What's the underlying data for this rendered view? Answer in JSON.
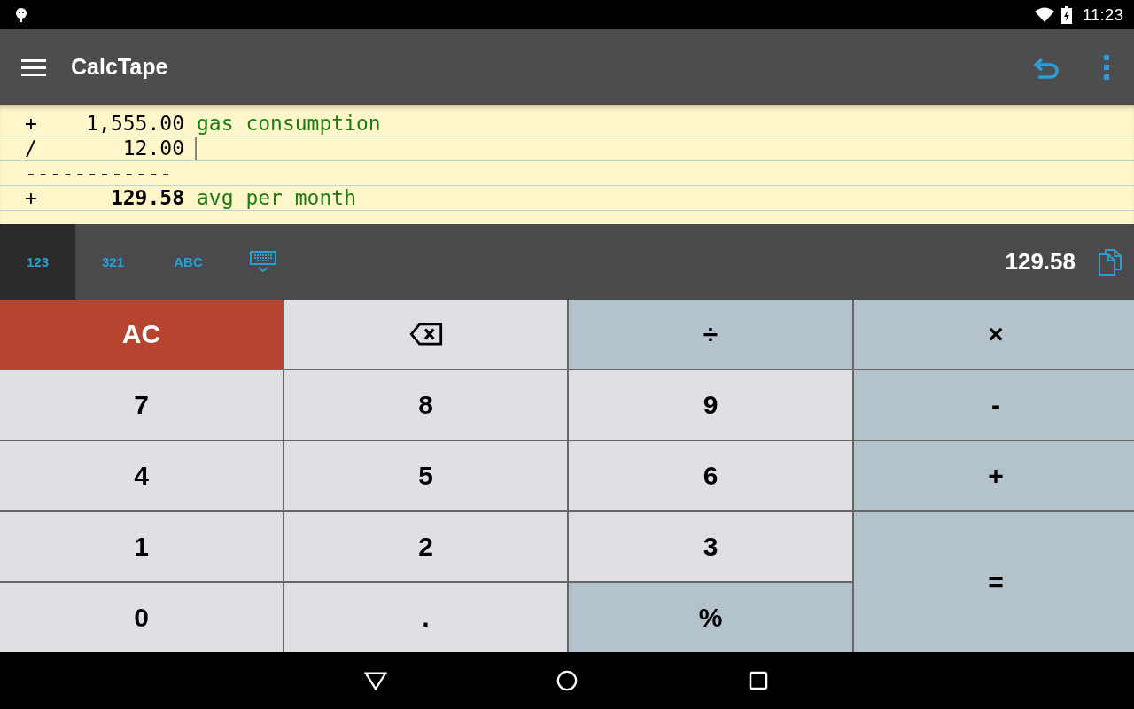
{
  "status_bar": {
    "time": "11:23"
  },
  "toolbar": {
    "title": "CalcTape"
  },
  "tape": [
    {
      "kind": "entry",
      "op": "+",
      "amount": "1,555.00",
      "comment": "gas consumption",
      "bold": false,
      "cursor": false
    },
    {
      "kind": "entry",
      "op": "/",
      "amount": "12.00",
      "bold": false,
      "cursor": true
    },
    {
      "kind": "separator",
      "text": "------------"
    },
    {
      "kind": "entry",
      "op": "+",
      "amount": "129.58",
      "comment": "avg per month",
      "bold": true,
      "cursor": false
    }
  ],
  "mode_tabs": [
    {
      "label": "123",
      "selected": true
    },
    {
      "label": "321",
      "selected": false
    },
    {
      "label": "ABC",
      "selected": false
    }
  ],
  "result": "129.58",
  "keys": [
    {
      "kind": "clear",
      "label": "AC"
    },
    {
      "kind": "backspace"
    },
    {
      "kind": "op",
      "label": "÷"
    },
    {
      "kind": "op",
      "label": "×"
    },
    {
      "kind": "digit",
      "label": "7"
    },
    {
      "kind": "digit",
      "label": "8"
    },
    {
      "kind": "digit",
      "label": "9"
    },
    {
      "kind": "op",
      "label": "-"
    },
    {
      "kind": "digit",
      "label": "4"
    },
    {
      "kind": "digit",
      "label": "5"
    },
    {
      "kind": "digit",
      "label": "6"
    },
    {
      "kind": "op",
      "label": "+"
    },
    {
      "kind": "digit",
      "label": "1"
    },
    {
      "kind": "digit",
      "label": "2"
    },
    {
      "kind": "digit",
      "label": "3"
    },
    {
      "kind": "equals",
      "label": "="
    },
    {
      "kind": "digit",
      "label": "0"
    },
    {
      "kind": "digit",
      "label": "."
    },
    {
      "kind": "op",
      "label": "%"
    }
  ]
}
